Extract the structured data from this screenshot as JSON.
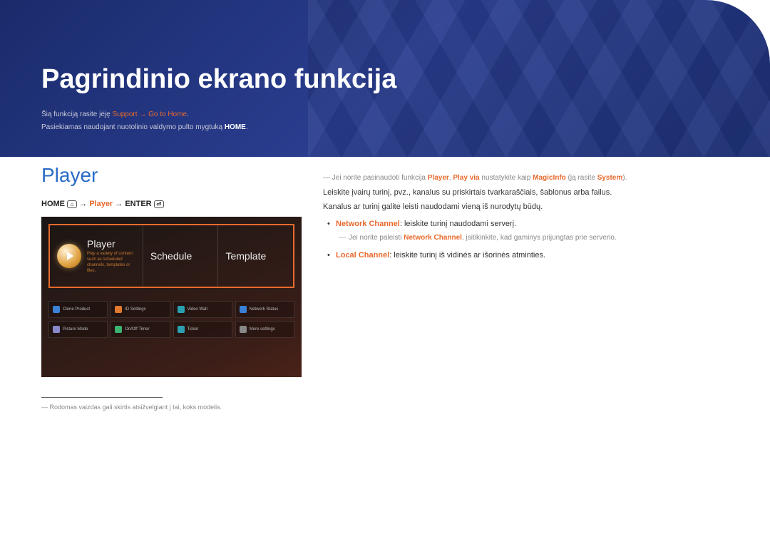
{
  "page": {
    "title": "Pagrindinio ekrano funkcija",
    "intro_line1_a": "Šią funkciją rasite įėję ",
    "intro_line1_hl": "Support → Go to Home",
    "intro_line1_b": ".",
    "intro_line2_a": "Pasiekiamas naudojant nuotolinio valdymo pulto mygtuką ",
    "intro_line2_bold": "HOME",
    "intro_line2_b": "."
  },
  "section": {
    "title": "Player",
    "bc_home": "HOME",
    "bc_arrow1": " → ",
    "bc_player": "Player",
    "bc_arrow2": " → ",
    "bc_enter": "ENTER"
  },
  "shot": {
    "player_label": "Player",
    "player_sub": "Play a variety of content such as scheduled channels, templates or files.",
    "schedule_label": "Schedule",
    "template_label": "Template",
    "minis": [
      "Clone Product",
      "ID Settings",
      "Video Wall",
      "Network Status",
      "Picture Mode",
      "On/Off Timer",
      "Ticker",
      "More settings"
    ]
  },
  "footnote": "Rodomas vaizdas gali skirtis atsižvelgiant į tai, koks modelis.",
  "right": {
    "note1_pre": "Jei norite pasinaudoti funkcija ",
    "note1_player": "Player",
    "note1_mid1": ", ",
    "note1_playvia": "Play via",
    "note1_mid2": " nustatykite kaip ",
    "note1_magic": "MagicInfo",
    "note1_mid3": " (ją rasite ",
    "note1_system": "System",
    "note1_end": ").",
    "p1": "Leiskite įvairų turinį, pvz., kanalus su priskirtais tvarkaraščiais, šablonus arba failus.",
    "p2": "Kanalus ar turinį galite leisti naudodami vieną iš nurodytų būdų.",
    "li1_hl": "Network Channel",
    "li1_txt": ": leiskite turinį naudodami serverį.",
    "sub_pre": "Jei norite paleisti ",
    "sub_hl": "Network Channel",
    "sub_post": ", įsitikinkite, kad gaminys prijungtas prie serverio.",
    "li2_hl": "Local Channel",
    "li2_txt": ": leiskite turinį iš vidinės ar išorinės atminties."
  }
}
